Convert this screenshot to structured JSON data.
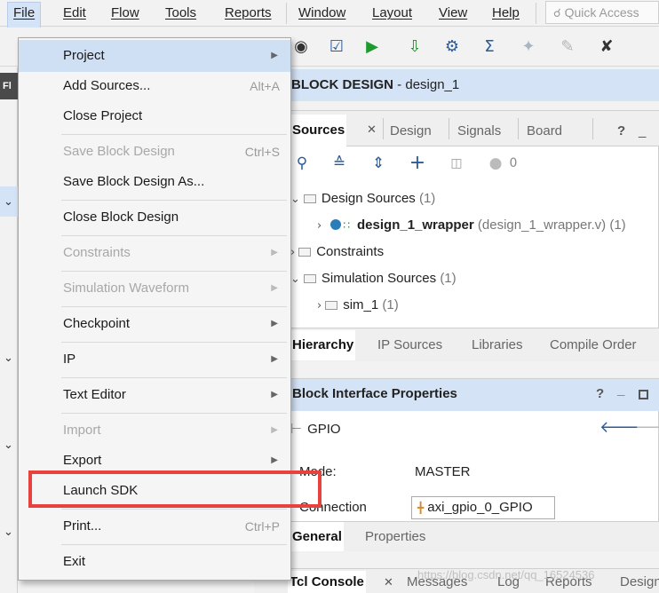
{
  "menubar": {
    "items": [
      "File",
      "Edit",
      "Flow",
      "Tools",
      "Reports",
      "Window",
      "Layout",
      "View",
      "Help"
    ],
    "quick_access_placeholder": "Quick Access"
  },
  "header": {
    "prefix": "BLOCK DESIGN",
    "design": " - design_1"
  },
  "left_strip": {
    "label": "Fl"
  },
  "sources": {
    "tabs": [
      "Sources",
      "Design",
      "Signals",
      "Board"
    ],
    "help": "?",
    "tool_count": "0",
    "tree": [
      {
        "label": "Design Sources",
        "count": "(1)"
      },
      {
        "label": "design_1_wrapper",
        "detail": "(design_1_wrapper.v) (1)"
      },
      {
        "label": "Constraints"
      },
      {
        "label": "Simulation Sources",
        "count": "(1)"
      },
      {
        "label": "sim_1",
        "count": "(1)"
      }
    ],
    "bottom_tabs": [
      "Hierarchy",
      "IP Sources",
      "Libraries",
      "Compile Order"
    ]
  },
  "props": {
    "title": "Block Interface Properties",
    "help": "?",
    "name": "GPIO",
    "mode_label": "Mode:",
    "mode_value": "MASTER",
    "connection_label": "Connection",
    "connection_value": "axi_gpio_0_GPIO",
    "tabs": [
      "General",
      "Properties"
    ]
  },
  "tcl": {
    "tabs": [
      "Tcl Console",
      "Messages",
      "Log",
      "Reports",
      "Design"
    ]
  },
  "file_menu": {
    "items": [
      {
        "label": "Project",
        "submenu": true,
        "highlight": true
      },
      {
        "label": "Add Sources...",
        "shortcut": "Alt+A"
      },
      {
        "label": "Close Project"
      },
      {
        "label": "Save Block Design",
        "shortcut": "Ctrl+S",
        "disabled": true
      },
      {
        "label": "Save Block Design As..."
      },
      {
        "label": "Close Block Design"
      },
      {
        "label": "Constraints",
        "submenu": true,
        "disabled": true
      },
      {
        "label": "Simulation Waveform",
        "submenu": true,
        "disabled": true
      },
      {
        "label": "Checkpoint",
        "submenu": true
      },
      {
        "label": "IP",
        "submenu": true
      },
      {
        "label": "Text Editor",
        "submenu": true
      },
      {
        "label": "Import",
        "submenu": true,
        "disabled": true
      },
      {
        "label": "Export",
        "submenu": true
      },
      {
        "label": "Launch SDK"
      },
      {
        "label": "Print...",
        "shortcut": "Ctrl+P"
      },
      {
        "label": "Exit"
      }
    ]
  },
  "watermark": "https://blog.csdn.net/qq_16524536",
  "colors": {
    "menu_highlight": "#cfdff4",
    "header_blue": "#d5e3f6",
    "annotation_red": "#e8423f",
    "tree_node": "#2a7db8"
  }
}
